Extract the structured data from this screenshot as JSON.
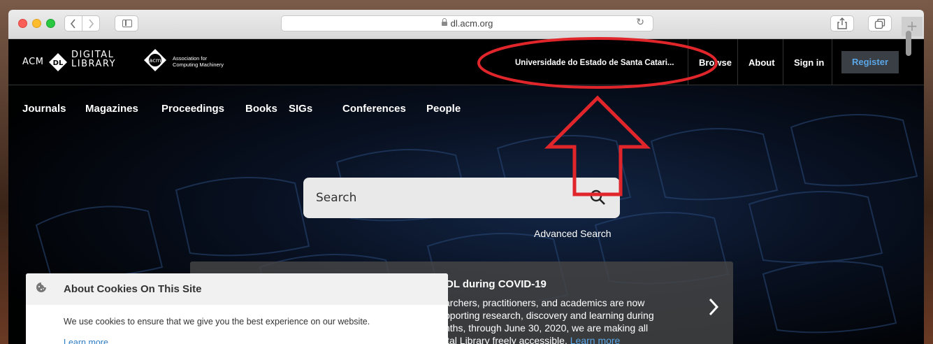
{
  "browser": {
    "url": "dl.acm.org"
  },
  "header": {
    "logo_acm": "ACM",
    "logo_dl_words": [
      "DIGITAL",
      "LIBRARY"
    ],
    "acm_association": [
      "Association for",
      "Computing Machinery"
    ],
    "institution": "Universidade do Estado de Santa Catari...",
    "browse": "Browse",
    "about": "About",
    "sign_in": "Sign in",
    "register": "Register"
  },
  "subnav": [
    "Journals",
    "Magazines",
    "Proceedings",
    "Books",
    "SIGs",
    "Conferences",
    "People"
  ],
  "search": {
    "placeholder": "Search",
    "advanced": "Advanced Search"
  },
  "covid_banner": {
    "title": "DL during COVID-19",
    "lines": [
      "archers, practitioners, and academics are now",
      "pporting research, discovery and learning during",
      "nths, through June 30, 2020, we are making all",
      "ital Library freely accessible."
    ],
    "learn_more": "Learn more"
  },
  "cookie_notice": {
    "title": "About Cookies On This Site",
    "body": "We use cookies to ensure that we give you the best experience on our website.",
    "link": "Learn more"
  },
  "colors": {
    "accent_blue": "#5aa6e6",
    "annotation_red": "#e0262a"
  }
}
